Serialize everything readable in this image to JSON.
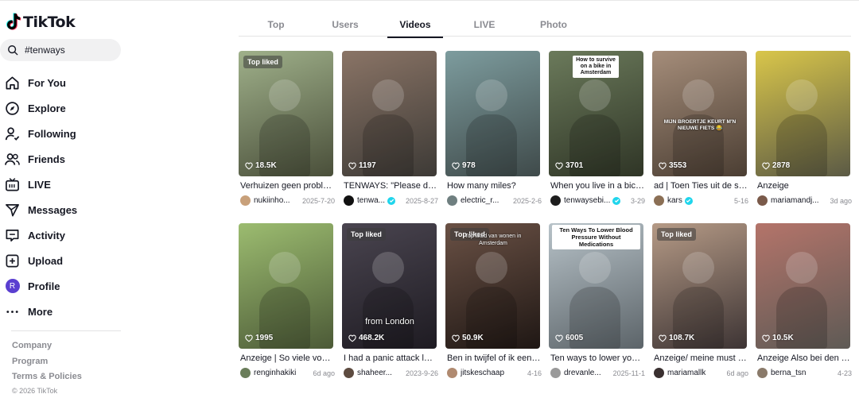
{
  "app": {
    "name": "TikTok"
  },
  "search": {
    "query": "#tenways"
  },
  "nav": {
    "items": [
      {
        "label": "For You",
        "icon": "home-icon"
      },
      {
        "label": "Explore",
        "icon": "compass-icon"
      },
      {
        "label": "Following",
        "icon": "user-follow-icon"
      },
      {
        "label": "Friends",
        "icon": "friends-icon"
      },
      {
        "label": "LIVE",
        "icon": "live-icon"
      },
      {
        "label": "Messages",
        "icon": "send-icon"
      },
      {
        "label": "Activity",
        "icon": "message-box-icon"
      },
      {
        "label": "Upload",
        "icon": "plus-square-icon"
      },
      {
        "label": "Profile",
        "icon": "avatar",
        "avatar_letter": "R"
      },
      {
        "label": "More",
        "icon": "more-dots-icon"
      }
    ]
  },
  "footer": {
    "links": [
      "Company",
      "Program",
      "Terms & Policies"
    ],
    "copyright": "© 2026 TikTok"
  },
  "tabs": [
    {
      "label": "Top",
      "active": false
    },
    {
      "label": "Users",
      "active": false
    },
    {
      "label": "Videos",
      "active": true
    },
    {
      "label": "LIVE",
      "active": false
    },
    {
      "label": "Photo",
      "active": false
    }
  ],
  "videos": [
    {
      "badge": "Top liked",
      "views": "18.5K",
      "caption": "Verhuizen geen proble...",
      "author": "nukiinho...",
      "verified": false,
      "date": "2025-7-20",
      "overlay": "",
      "colors": [
        "#9fb08a",
        "#4a4f3a"
      ],
      "avatar_color": "#c8a07a"
    },
    {
      "badge": "",
      "views": "1197",
      "caption": "TENWAYS: \"Please do...",
      "author": "tenwa...",
      "verified": true,
      "date": "2025-8-27",
      "overlay": "",
      "colors": [
        "#8a7466",
        "#3d3a36"
      ],
      "avatar_color": "#111111"
    },
    {
      "badge": "",
      "views": "978",
      "caption": "How many miles?",
      "author": "electric_r...",
      "verified": false,
      "date": "2025-2-6",
      "overlay": "",
      "colors": [
        "#7d9c9e",
        "#3f4a4a"
      ],
      "avatar_color": "#6f7f80"
    },
    {
      "badge": "",
      "views": "3701",
      "caption": "When you live in a bicy...",
      "author": "tenwaysebi...",
      "verified": true,
      "date": "3-29",
      "overlay": "How to survive on a bike in Amsterdam",
      "colors": [
        "#6b7a5b",
        "#2f3526"
      ],
      "avatar_color": "#1d1d1d"
    },
    {
      "badge": "",
      "views": "3553",
      "caption": "ad | Toen Ties uit de sc...",
      "author": "kars",
      "verified": true,
      "date": "5-16",
      "overlay": "MIJN BROERTJE KEURT M'N NIEUWE FIETS 😂",
      "colors": [
        "#a58d7a",
        "#4b3e33"
      ],
      "avatar_color": "#8b6f55"
    },
    {
      "badge": "",
      "views": "2878",
      "caption": "Anzeige",
      "author": "mariamandj...",
      "verified": false,
      "date": "3d ago",
      "overlay": "",
      "colors": [
        "#d9c64a",
        "#5b5a45"
      ],
      "avatar_color": "#7a5a4a"
    },
    {
      "badge": "",
      "views": "1995",
      "caption": "Anzeige | So viele von ...",
      "author": "renginhakiki",
      "verified": false,
      "date": "6d ago",
      "overlay": "",
      "colors": [
        "#9cbc70",
        "#4c5a37"
      ],
      "avatar_color": "#6a7d5a"
    },
    {
      "badge": "Top liked",
      "views": "468.2K",
      "caption": "I had a panic attack les...",
      "author": "shaheer...",
      "verified": false,
      "date": "2023-9-26",
      "overlay": "from London",
      "colors": [
        "#4a4550",
        "#1e1b22"
      ],
      "avatar_color": "#5d4b40"
    },
    {
      "badge": "Top liked",
      "views": "50.9K",
      "caption": "Ben in twijfel of ik een ...",
      "author": "jitskeschaap",
      "verified": false,
      "date": "4-16",
      "overlay": "Top liked van wonen in Amsterdam",
      "colors": [
        "#6a5145",
        "#1f1714"
      ],
      "avatar_color": "#b08a70"
    },
    {
      "badge": "",
      "views": "6005",
      "caption": "Ten ways to lower your...",
      "author": "drevanle...",
      "verified": false,
      "date": "2025-11-1",
      "overlay": "Ten Ways To Lower Blood Pressure Without Medications",
      "colors": [
        "#b7c2c8",
        "#5c6469"
      ],
      "avatar_color": "#9a9a9a"
    },
    {
      "badge": "Top liked",
      "views": "108.7K",
      "caption": "Anzeige/ meine must h...",
      "author": "mariamallk",
      "verified": false,
      "date": "6d ago",
      "overlay": "",
      "colors": [
        "#b59a86",
        "#3d3434"
      ],
      "avatar_color": "#3a3030"
    },
    {
      "badge": "",
      "views": "10.5K",
      "caption": "Anzeige Also bei den T...",
      "author": "berna_tsn",
      "verified": false,
      "date": "4-23",
      "overlay": "",
      "colors": [
        "#b4746a",
        "#5e5a55"
      ],
      "avatar_color": "#8a7a6a"
    }
  ]
}
